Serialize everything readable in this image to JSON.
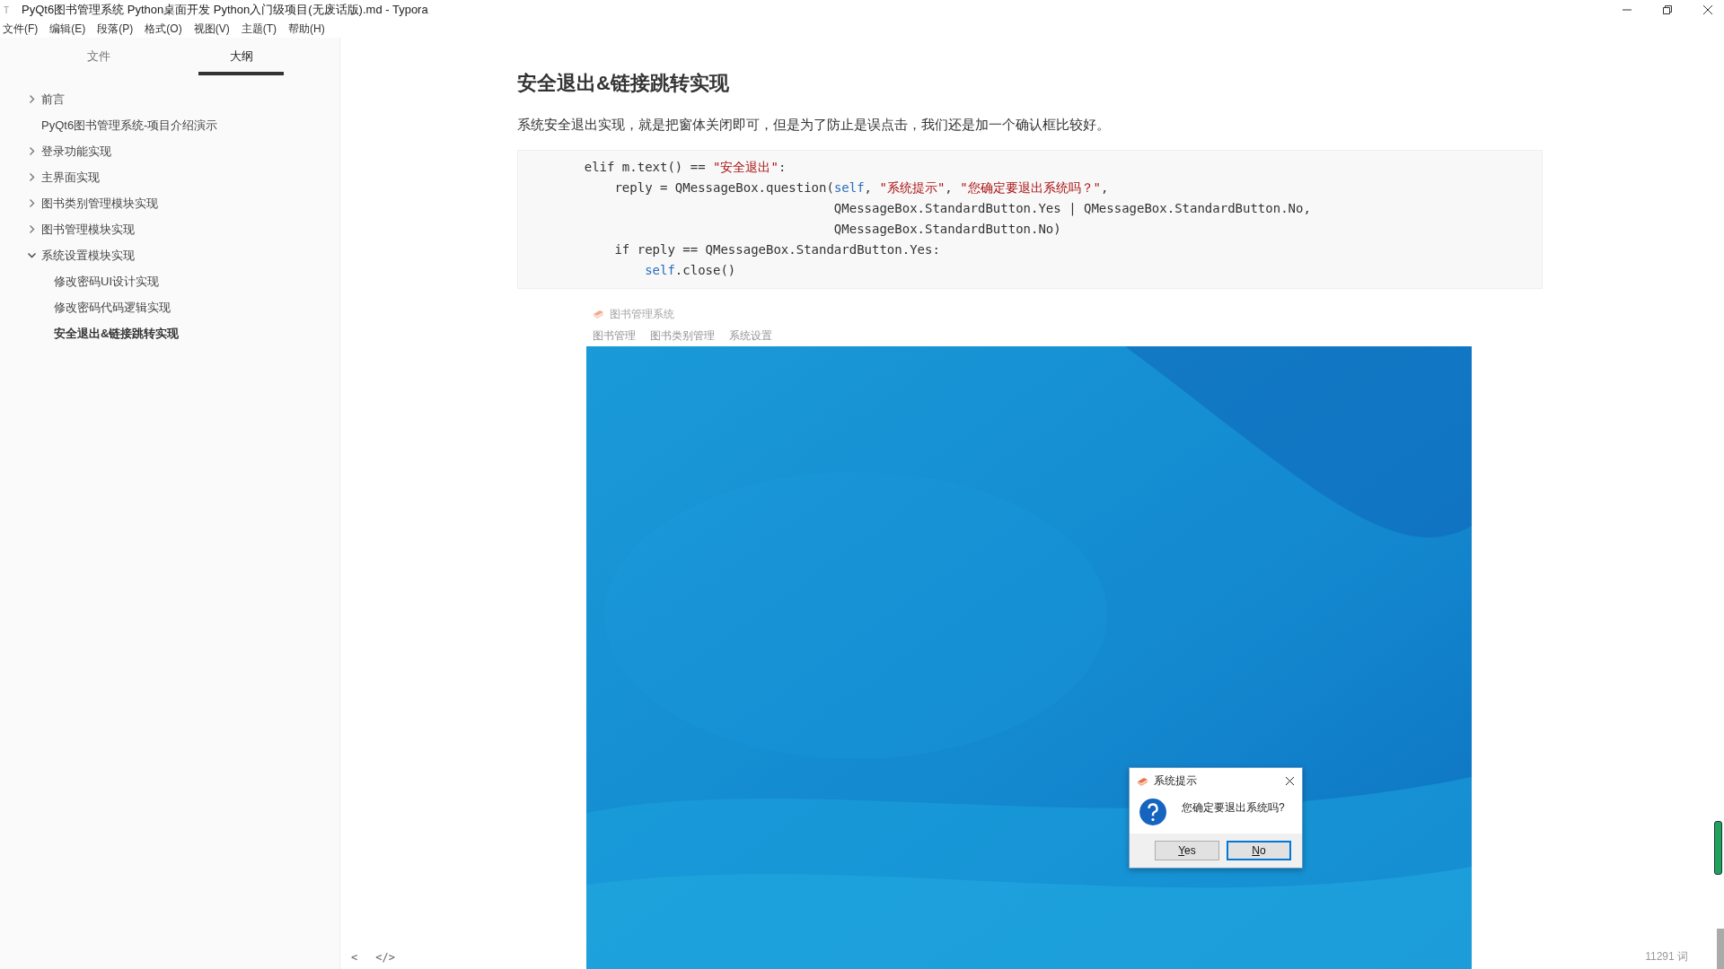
{
  "window": {
    "icon": "T",
    "title": "PyQt6图书管理系统 Python桌面开发 Python入门级项目(无废话版).md - Typora"
  },
  "menu": [
    "文件(F)",
    "编辑(E)",
    "段落(P)",
    "格式(O)",
    "视图(V)",
    "主题(T)",
    "帮助(H)"
  ],
  "sidebar": {
    "tabs": [
      {
        "label": "文件",
        "selected": false
      },
      {
        "label": "大纲",
        "selected": true
      }
    ],
    "outline": [
      {
        "label": "前言",
        "kind": "folder",
        "expanded": false,
        "selected": false
      },
      {
        "label": "PyQt6图书管理系统-项目介绍演示",
        "kind": "leaf",
        "selected": false
      },
      {
        "label": "登录功能实现",
        "kind": "folder",
        "expanded": false,
        "selected": false
      },
      {
        "label": "主界面实现",
        "kind": "folder",
        "expanded": false,
        "selected": false
      },
      {
        "label": "图书类别管理模块实现",
        "kind": "folder",
        "expanded": false,
        "selected": false
      },
      {
        "label": "图书管理模块实现",
        "kind": "folder",
        "expanded": false,
        "selected": false
      },
      {
        "label": "系统设置模块实现",
        "kind": "folder",
        "expanded": true,
        "selected": false,
        "children": [
          {
            "label": "修改密码UI设计实现",
            "selected": false
          },
          {
            "label": "修改密码代码逻辑实现",
            "selected": false
          },
          {
            "label": "安全退出&链接跳转实现",
            "selected": true
          }
        ]
      }
    ]
  },
  "document": {
    "heading": "安全退出&链接跳转实现",
    "paragraph": "系统安全退出实现，就是把窗体关闭即可，但是为了防止是误点击，我们还是加一个确认框比较好。",
    "code": [
      [
        {
          "kind": "plain",
          "text": "    elif m.text() == "
        },
        {
          "kind": "string",
          "text": "\"安全退出\""
        },
        {
          "kind": "plain",
          "text": ":"
        }
      ],
      [
        {
          "kind": "plain",
          "text": "        reply = QMessageBox.question("
        },
        {
          "kind": "self",
          "text": "self"
        },
        {
          "kind": "plain",
          "text": ", "
        },
        {
          "kind": "string",
          "text": "\"系统提示\""
        },
        {
          "kind": "plain",
          "text": ", "
        },
        {
          "kind": "string",
          "text": "\"您确定要退出系统吗？\""
        },
        {
          "kind": "plain",
          "text": ","
        }
      ],
      [
        {
          "kind": "plain",
          "text": "                                     QMessageBox.StandardButton.Yes | QMessageBox.StandardButton.No,"
        }
      ],
      [
        {
          "kind": "plain",
          "text": "                                     QMessageBox.StandardButton.No)"
        }
      ],
      [
        {
          "kind": "plain",
          "text": "        if reply == QMessageBox.StandardButton.Yes:"
        }
      ],
      [
        {
          "kind": "self",
          "text": "            self"
        },
        {
          "kind": "plain",
          "text": ".close()"
        }
      ]
    ],
    "screenshot": {
      "app_title": "图书管理系统",
      "tabs": [
        "图书管理",
        "图书类别管理",
        "系统设置"
      ],
      "dialog": {
        "title": "系统提示",
        "message": "您确定要退出系统吗?",
        "buttons": [
          {
            "label": "Yes",
            "selected": false
          },
          {
            "label": "No",
            "selected": true
          }
        ]
      }
    }
  },
  "status_bar": {
    "word_count": "11291 词",
    "buttons": [
      "<",
      "</>"
    ]
  }
}
